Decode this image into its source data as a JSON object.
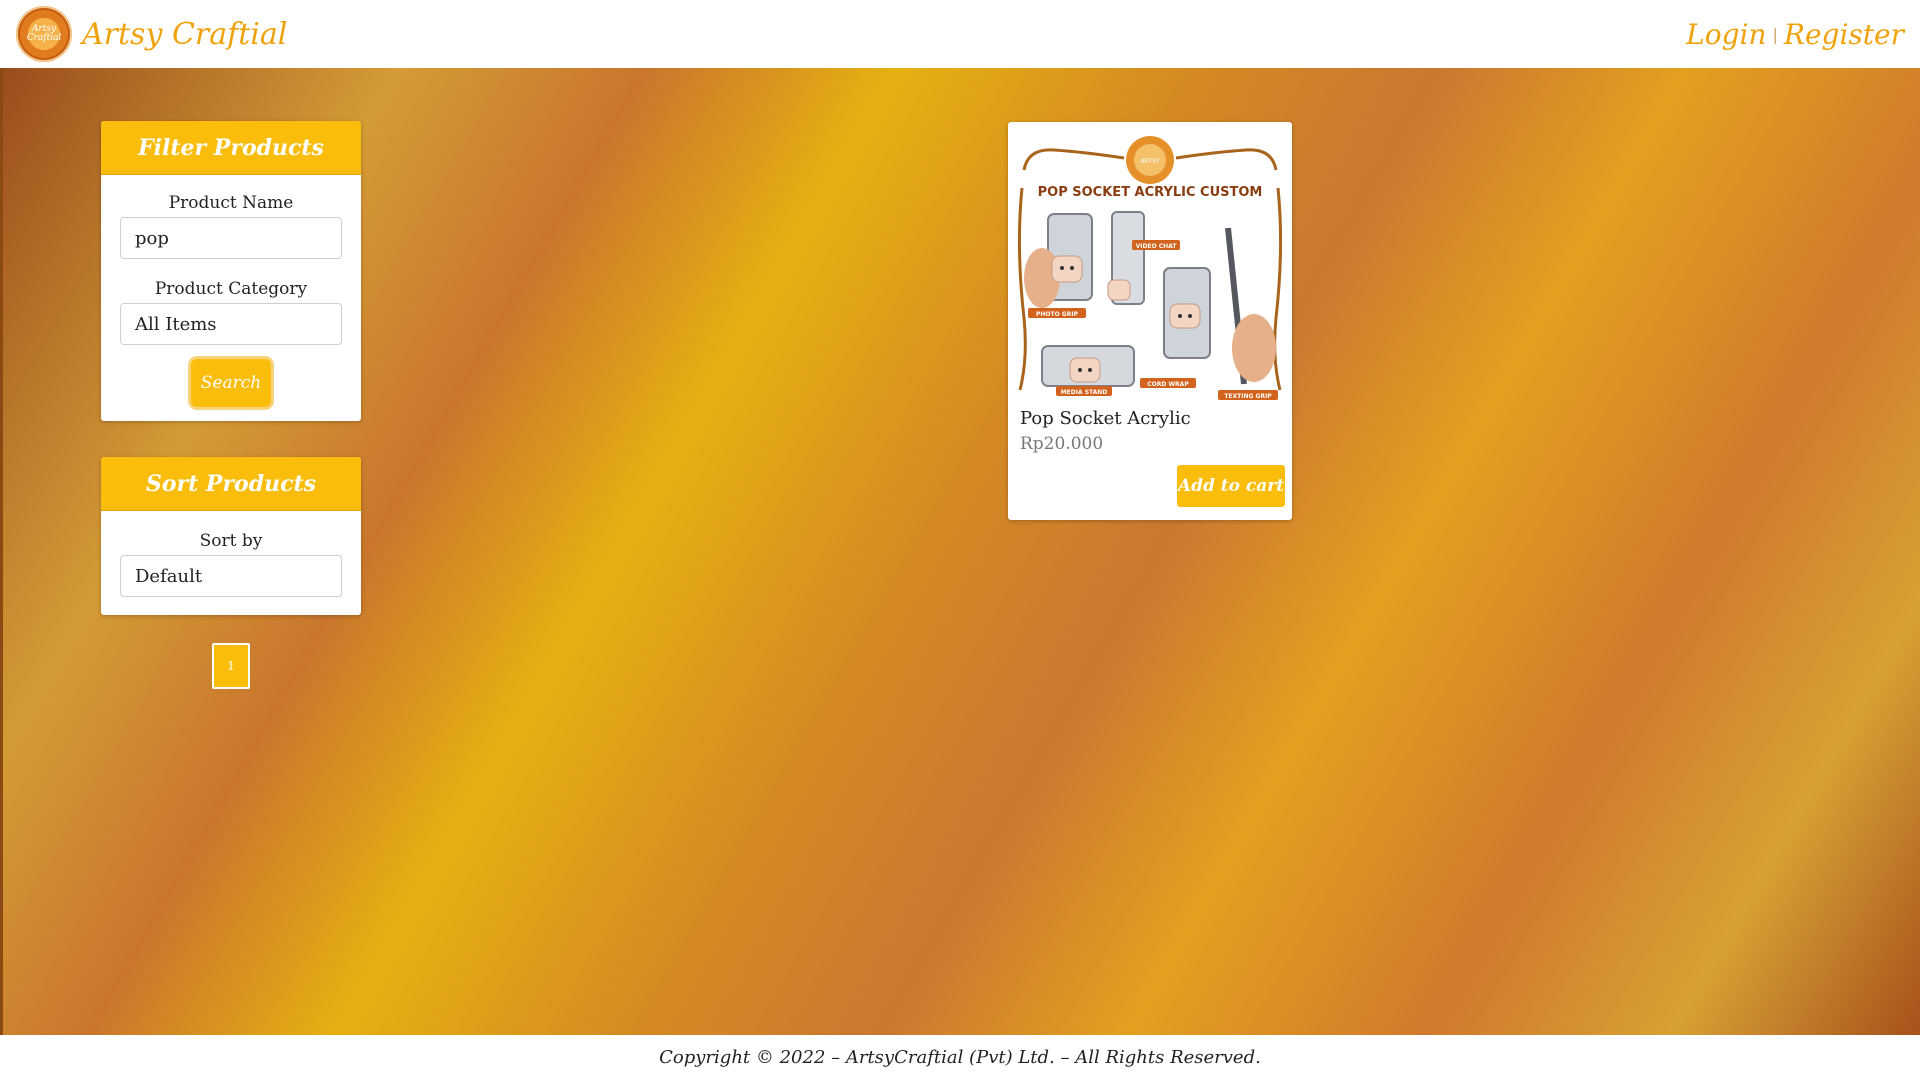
{
  "navbar": {
    "logo_text": "Artsy Craftial",
    "brand": "Artsy Craftial",
    "login": "Login",
    "separator": "|",
    "register": "Register"
  },
  "filter": {
    "title": "Filter Products",
    "name_label": "Product Name",
    "name_value": "pop",
    "category_label": "Product Category",
    "category_value": "All Items",
    "search_label": "Search"
  },
  "sort": {
    "title": "Sort Products",
    "label": "Sort by",
    "value": "Default"
  },
  "pagination": {
    "current": "1"
  },
  "product": {
    "image_heading": "POP SOCKET ACRYLIC CUSTOM",
    "image_tags": [
      "VIDEO CHAT",
      "PHOTO GRIP",
      "MEDIA STAND",
      "CORD WRAP",
      "TEXTING GRIP"
    ],
    "name": "Pop Socket Acrylic",
    "price": "Rp20.000",
    "cart_label": "Add to cart"
  },
  "footer": {
    "text": "Copyright © 2022 – ArtsyCraftial (Pvt) Ltd. – All Rights Reserved."
  },
  "colors": {
    "accent": "#fbbd0b",
    "brand_text": "#f0a20c"
  }
}
